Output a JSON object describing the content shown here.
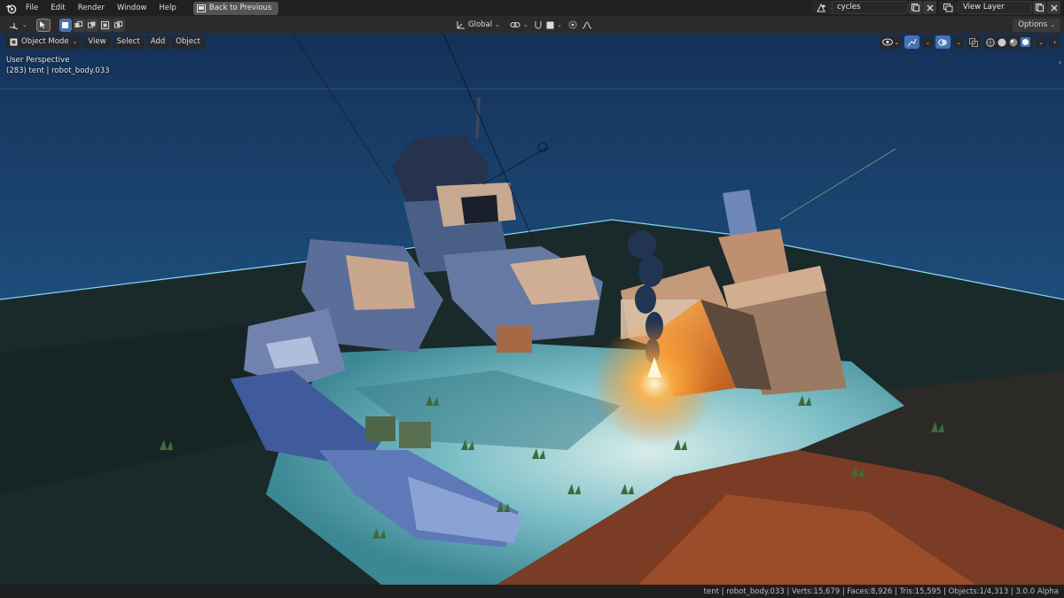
{
  "menu": {
    "items": [
      "File",
      "Edit",
      "Render",
      "Window",
      "Help"
    ],
    "back_label": "Back to Previous"
  },
  "scene": {
    "scene_name": "cycles",
    "view_layer": "View Layer"
  },
  "header": {
    "orientation": "Global",
    "options_label": "Options"
  },
  "viewport": {
    "mode_label": "Object Mode",
    "menus": [
      "View",
      "Select",
      "Add",
      "Object"
    ],
    "perspective_label": "User Perspective",
    "object_info": "(283) tent | robot_body.033"
  },
  "status": {
    "text": "tent | robot_body.033 | Verts:15,679 | Faces:8,926 | Tris:15,595 | Objects:1/4,313 | 3.0.0 Alpha"
  },
  "colors": {
    "accent": "#4772b3",
    "sky": "#1b3a5e",
    "fire": "#ff9a2e"
  }
}
